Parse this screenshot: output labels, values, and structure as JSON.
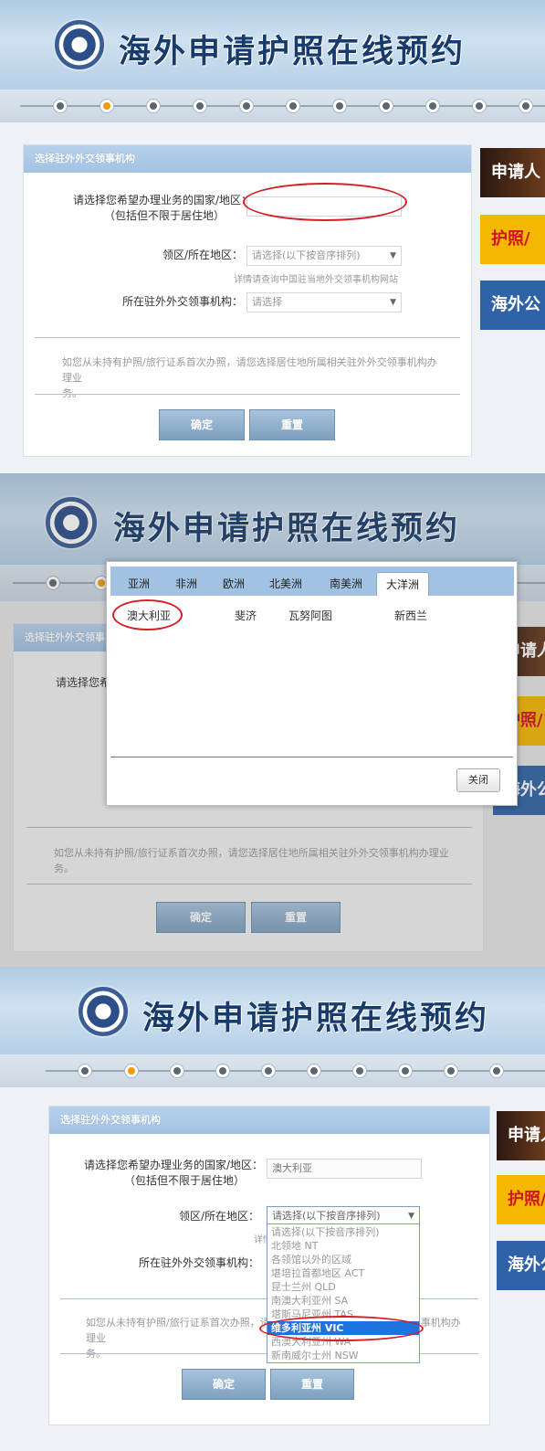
{
  "site_title": "海外申请护照在线预约",
  "section_title": "选择驻外外交领事机构",
  "form": {
    "country_label_1": "请选择您希望办理业务的国家/地区：",
    "country_label_2": "（包括但不限于居住地）",
    "district_label": "领区/所在地区：",
    "district_placeholder": "请选择(以下按音序排列)",
    "district_hint": "详情请查询中国驻当地外交领事机构网站",
    "consulate_label": "所在驻外外交领事机构：",
    "consulate_placeholder": "请选择",
    "notice_line_1": "如您从未持有护照/旅行证系首次办照，请您选择居住地所属相关驻外外交领事机构办理业",
    "notice_line_2": "务。",
    "confirm_button": "确定",
    "reset_button": "重置"
  },
  "side_banners": [
    "申请人",
    "护照/",
    "海外公"
  ],
  "step2": {
    "tabs": [
      "亚洲",
      "非洲",
      "欧洲",
      "北美洲",
      "南美洲",
      "大洋洲"
    ],
    "active_tab": "大洋洲",
    "countries": [
      "澳大利亚",
      "斐济",
      "瓦努阿图",
      "新西兰"
    ],
    "close_button": "关闭"
  },
  "step3": {
    "country_value": "澳大利亚",
    "district_hint_partial": "详情",
    "options": [
      "请选择(以下按音序排列)",
      "北领地 NT",
      "各领馆以外的区域",
      "堪培拉首都地区 ACT",
      "昆士兰州 QLD",
      "南澳大利亚州 SA",
      "塔斯马尼亚州 TAS",
      "维多利亚州 VIC",
      "西澳大利亚州 WA",
      "新南威尔士州 NSW"
    ],
    "selected_option": "维多利亚州 VIC"
  },
  "colors": {
    "header_blue": "#aecbe4",
    "title_navy": "#173b6c",
    "active_step": "#f39a0c",
    "button_blue": "#7d9fbf",
    "highlight_red": "#d51f26",
    "selected_option_bg": "#1f73e0"
  }
}
